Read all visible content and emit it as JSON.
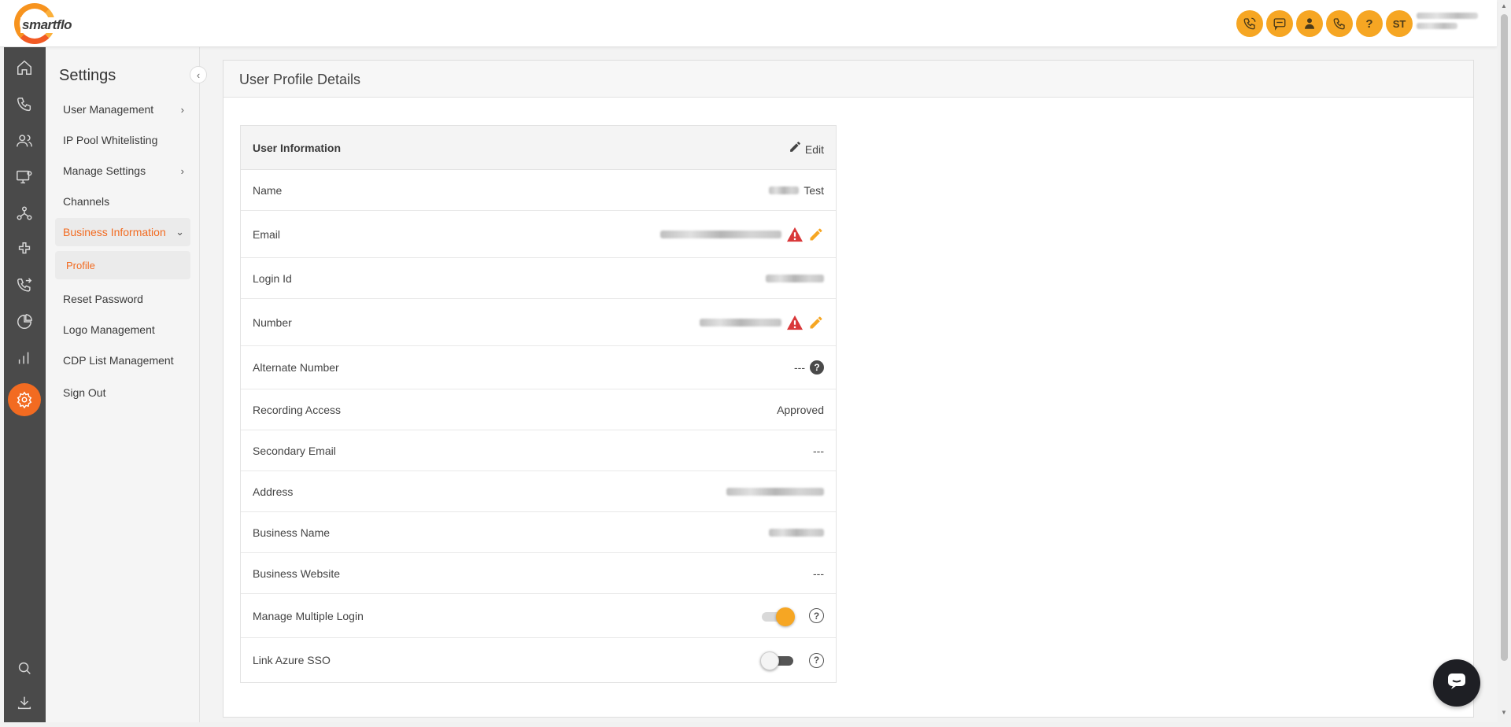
{
  "header": {
    "logo_text": "smartflo",
    "icons": [
      "phone-ring-icon",
      "sms-icon",
      "agent-icon",
      "call-icon",
      "help-icon"
    ],
    "help_glyph": "?",
    "avatar_initials": "ST"
  },
  "rail": {
    "items": [
      "home-icon",
      "phone-icon",
      "users-icon",
      "monitor-settings-icon",
      "network-icon",
      "integrations-icon",
      "call-forward-icon",
      "pie-chart-icon",
      "bar-chart-icon",
      "settings-icon"
    ],
    "bottom": [
      "search-icon",
      "download-icon"
    ]
  },
  "sidebar": {
    "title": "Settings",
    "collapse_glyph": "‹",
    "items": [
      {
        "label": "User Management",
        "has_chevron": true
      },
      {
        "label": "IP Pool Whitelisting"
      },
      {
        "label": "Manage Settings",
        "has_chevron": true
      },
      {
        "label": "Channels"
      },
      {
        "label": "Business Information",
        "expanded": true
      },
      {
        "label": "Reset Password"
      },
      {
        "label": "Logo Management"
      },
      {
        "label": "CDP List Management"
      },
      {
        "label": "Sign Out"
      }
    ],
    "sub_item": "Profile",
    "chevron_right": "›",
    "chevron_down": "⌄"
  },
  "panel": {
    "title": "User Profile Details"
  },
  "info": {
    "title": "User Information",
    "edit_label": "Edit",
    "rows": [
      {
        "label": "Name",
        "value": "Test"
      },
      {
        "label": "Email"
      },
      {
        "label": "Login Id"
      },
      {
        "label": "Number"
      },
      {
        "label": "Alternate Number",
        "value": "---"
      },
      {
        "label": "Recording Access",
        "value": "Approved"
      },
      {
        "label": "Secondary Email",
        "value": "---"
      },
      {
        "label": "Address"
      },
      {
        "label": "Business Name"
      },
      {
        "label": "Business Website",
        "value": "---"
      },
      {
        "label": "Manage Multiple Login",
        "toggle": "on"
      },
      {
        "label": "Link Azure SSO",
        "toggle": "off"
      }
    ],
    "help_glyph": "?"
  },
  "colors": {
    "accent": "#f26b21",
    "header_icon_bg": "#f6a623",
    "rail_bg": "#4a4a4a",
    "warning": "#d9383a"
  }
}
